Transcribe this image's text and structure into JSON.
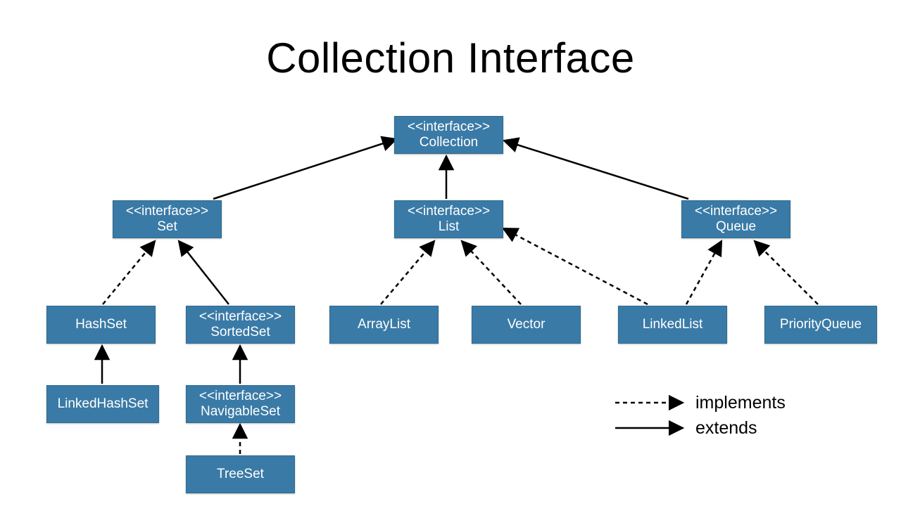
{
  "title": "Collection Interface",
  "stereotype": "<<interface>>",
  "nodes": {
    "collection": {
      "label": "Collection",
      "interface": true
    },
    "set": {
      "label": "Set",
      "interface": true
    },
    "list": {
      "label": "List",
      "interface": true
    },
    "queue": {
      "label": "Queue",
      "interface": true
    },
    "hashset": {
      "label": "HashSet",
      "interface": false
    },
    "sortedset": {
      "label": "SortedSet",
      "interface": true
    },
    "linkedhashset": {
      "label": "LinkedHashSet",
      "interface": false
    },
    "navigableset": {
      "label": "NavigableSet",
      "interface": true
    },
    "treeset": {
      "label": "TreeSet",
      "interface": false
    },
    "arraylist": {
      "label": "ArrayList",
      "interface": false
    },
    "vector": {
      "label": "Vector",
      "interface": false
    },
    "linkedlist": {
      "label": "LinkedList",
      "interface": false
    },
    "priorityqueue": {
      "label": "PriorityQueue",
      "interface": false
    }
  },
  "legend": {
    "implements": "implements",
    "extends": "extends"
  },
  "chart_data": {
    "type": "hierarchy-diagram",
    "title": "Collection Interface",
    "nodes": [
      {
        "id": "Collection",
        "stereotype": "interface"
      },
      {
        "id": "Set",
        "stereotype": "interface"
      },
      {
        "id": "List",
        "stereotype": "interface"
      },
      {
        "id": "Queue",
        "stereotype": "interface"
      },
      {
        "id": "SortedSet",
        "stereotype": "interface"
      },
      {
        "id": "NavigableSet",
        "stereotype": "interface"
      },
      {
        "id": "HashSet",
        "stereotype": "class"
      },
      {
        "id": "LinkedHashSet",
        "stereotype": "class"
      },
      {
        "id": "TreeSet",
        "stereotype": "class"
      },
      {
        "id": "ArrayList",
        "stereotype": "class"
      },
      {
        "id": "Vector",
        "stereotype": "class"
      },
      {
        "id": "LinkedList",
        "stereotype": "class"
      },
      {
        "id": "PriorityQueue",
        "stereotype": "class"
      }
    ],
    "edges": [
      {
        "from": "Set",
        "to": "Collection",
        "relation": "extends"
      },
      {
        "from": "List",
        "to": "Collection",
        "relation": "extends"
      },
      {
        "from": "Queue",
        "to": "Collection",
        "relation": "extends"
      },
      {
        "from": "SortedSet",
        "to": "Set",
        "relation": "extends"
      },
      {
        "from": "NavigableSet",
        "to": "SortedSet",
        "relation": "extends"
      },
      {
        "from": "LinkedHashSet",
        "to": "HashSet",
        "relation": "extends"
      },
      {
        "from": "HashSet",
        "to": "Set",
        "relation": "implements"
      },
      {
        "from": "TreeSet",
        "to": "NavigableSet",
        "relation": "implements"
      },
      {
        "from": "ArrayList",
        "to": "List",
        "relation": "implements"
      },
      {
        "from": "Vector",
        "to": "List",
        "relation": "implements"
      },
      {
        "from": "LinkedList",
        "to": "List",
        "relation": "implements"
      },
      {
        "from": "LinkedList",
        "to": "Queue",
        "relation": "implements"
      },
      {
        "from": "PriorityQueue",
        "to": "Queue",
        "relation": "implements"
      }
    ],
    "legend": [
      {
        "style": "dashed",
        "meaning": "implements"
      },
      {
        "style": "solid",
        "meaning": "extends"
      }
    ]
  }
}
